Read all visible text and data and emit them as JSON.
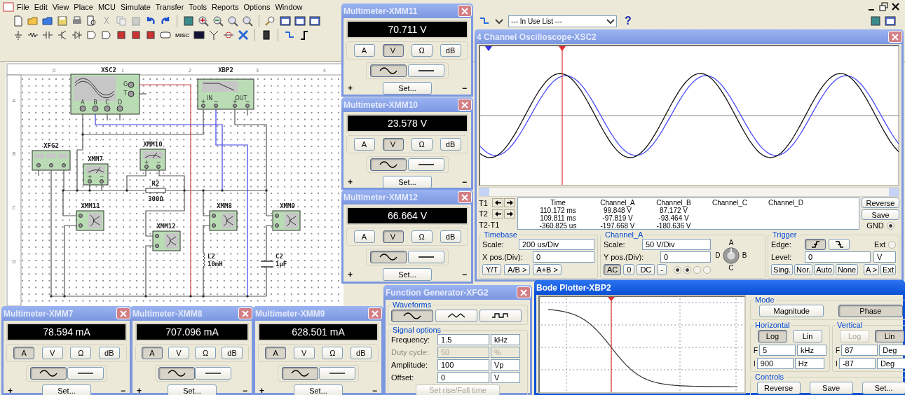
{
  "menu_bar": {
    "items": [
      "File",
      "Edit",
      "View",
      "Place",
      "MCU",
      "Simulate",
      "Transfer",
      "Tools",
      "Reports",
      "Options",
      "Window"
    ]
  },
  "toolbar": {
    "misc_label": "MISC"
  },
  "component_list": {
    "value": "--- In Use List ---"
  },
  "help_label": "?",
  "schematic": {
    "ruler_columns": [
      "0",
      "1",
      "2",
      "3",
      "4"
    ],
    "ruler_rows": [
      "A",
      "B",
      "C",
      "D"
    ],
    "components": [
      {
        "kind": "oscilloscope",
        "label": "XSC2",
        "pins": [
          "G",
          "T",
          "A",
          "B",
          "C",
          "D"
        ]
      },
      {
        "kind": "bode_plotter",
        "label": "XBP2",
        "ports": [
          "IN",
          "OUT"
        ],
        "pins": [
          "+",
          "−",
          "+",
          "−"
        ]
      },
      {
        "kind": "function_generator",
        "label": "XFG2"
      },
      {
        "kind": "voltmeter",
        "label": "XMM10",
        "pins": [
          "+",
          "−"
        ]
      },
      {
        "kind": "voltmeter",
        "label": "XMM7",
        "pins": [
          "+",
          "−"
        ]
      },
      {
        "kind": "resistor",
        "label": "R2",
        "value": "300Ω"
      },
      {
        "kind": "ammeter",
        "label": "XMM11"
      },
      {
        "kind": "ammeter",
        "label": "XMM8"
      },
      {
        "kind": "ammeter",
        "label": "XMM9"
      },
      {
        "kind": "ammeter",
        "label": "XMM12"
      },
      {
        "kind": "inductor",
        "label": "L2",
        "value": "10mH"
      },
      {
        "kind": "capacitor",
        "label": "C2",
        "value": "1μF"
      }
    ]
  },
  "multimeters": [
    {
      "title": "Multimeter-XMM11",
      "active": false,
      "reading": "70.711 V",
      "modes": [
        {
          "label": "A",
          "selected": false
        },
        {
          "label": "V",
          "selected": true
        },
        {
          "label": "Ω",
          "selected": false
        },
        {
          "label": "dB",
          "selected": false
        }
      ],
      "coupling": [
        {
          "kind": "ac",
          "selected": true
        },
        {
          "kind": "dc",
          "selected": false
        }
      ],
      "set_label": "Set...",
      "terminals": [
        "+",
        "−"
      ]
    },
    {
      "title": "Multimeter-XMM10",
      "active": false,
      "reading": "23.578 V",
      "modes": [
        {
          "label": "A",
          "selected": false
        },
        {
          "label": "V",
          "selected": true
        },
        {
          "label": "Ω",
          "selected": false
        },
        {
          "label": "dB",
          "selected": false
        }
      ],
      "coupling": [
        {
          "kind": "ac",
          "selected": true
        },
        {
          "kind": "dc",
          "selected": false
        }
      ],
      "set_label": "Set...",
      "terminals": [
        "+",
        "−"
      ]
    },
    {
      "title": "Multimeter-XMM12",
      "active": false,
      "reading": "66.664 V",
      "modes": [
        {
          "label": "A",
          "selected": false
        },
        {
          "label": "V",
          "selected": true
        },
        {
          "label": "Ω",
          "selected": false
        },
        {
          "label": "dB",
          "selected": false
        }
      ],
      "coupling": [
        {
          "kind": "ac",
          "selected": true
        },
        {
          "kind": "dc",
          "selected": false
        }
      ],
      "set_label": "Set...",
      "terminals": [
        "+",
        "−"
      ]
    },
    {
      "title": "Multimeter-XMM7",
      "active": false,
      "reading": "78.594 mA",
      "modes": [
        {
          "label": "A",
          "selected": true
        },
        {
          "label": "V",
          "selected": false
        },
        {
          "label": "Ω",
          "selected": false
        },
        {
          "label": "dB",
          "selected": false
        }
      ],
      "coupling": [
        {
          "kind": "ac",
          "selected": true
        },
        {
          "kind": "dc",
          "selected": false
        }
      ],
      "set_label": "Set...",
      "terminals": [
        "+",
        "−"
      ]
    },
    {
      "title": "Multimeter-XMM8",
      "active": false,
      "reading": "707.096 mA",
      "modes": [
        {
          "label": "A",
          "selected": true
        },
        {
          "label": "V",
          "selected": false
        },
        {
          "label": "Ω",
          "selected": false
        },
        {
          "label": "dB",
          "selected": false
        }
      ],
      "coupling": [
        {
          "kind": "ac",
          "selected": true
        },
        {
          "kind": "dc",
          "selected": false
        }
      ],
      "set_label": "Set...",
      "terminals": [
        "+",
        "−"
      ]
    },
    {
      "title": "Multimeter-XMM9",
      "active": false,
      "reading": "628.501 mA",
      "modes": [
        {
          "label": "A",
          "selected": true
        },
        {
          "label": "V",
          "selected": false
        },
        {
          "label": "Ω",
          "selected": false
        },
        {
          "label": "dB",
          "selected": false
        }
      ],
      "coupling": [
        {
          "kind": "ac",
          "selected": true
        },
        {
          "kind": "dc",
          "selected": false
        }
      ],
      "set_label": "Set...",
      "terminals": [
        "+",
        "−"
      ]
    }
  ],
  "oscilloscope": {
    "title": "4 Channel Oscilloscope-XSC2",
    "active": false,
    "cursor_rows": [
      {
        "label": "T1",
        "arrows": true
      },
      {
        "label": "T2",
        "arrows": true
      },
      {
        "label": "T2-T1",
        "arrows": false
      }
    ],
    "readout": {
      "columns": [
        "Time",
        "Channel_A",
        "Channel_B",
        "Channel_C",
        "Channel_D"
      ],
      "rows": [
        [
          "110.172 ms",
          "99.848 V",
          "87.172 V"
        ],
        [
          "109.811 ms",
          "-97.819 V",
          "-93.464 V"
        ],
        [
          "-360.825 us",
          "-197.668 V",
          "-180.636 V"
        ]
      ]
    },
    "side_buttons": [
      "Reverse",
      "Save"
    ],
    "gnd_label": "GND",
    "gnd_checked": true,
    "timebase": {
      "title": "Timebase",
      "scale_label": "Scale:",
      "scale": "200 us/Div",
      "xpos_label": "X pos.(Div):",
      "xpos": "0",
      "buttons": [
        "Y/T",
        "A/B >",
        "A+B >"
      ]
    },
    "channel": {
      "title": "Channel_A",
      "scale_label": "Scale:",
      "scale": "50  V/Div",
      "ypos_label": "Y pos.(Div):",
      "ypos": "0",
      "buttons": [
        {
          "label": "AC",
          "selected": true
        },
        {
          "label": "0",
          "selected": false
        },
        {
          "label": "DC",
          "selected": false
        },
        {
          "label": "-",
          "selected": false
        }
      ],
      "knob_labels": [
        "A",
        "B",
        "C",
        "D"
      ],
      "radios": [
        {
          "checked": true
        },
        {
          "checked": true
        },
        {
          "checked": false
        },
        {
          "checked": false
        }
      ]
    },
    "trigger": {
      "title": "Trigger",
      "edge_label": "Edge:",
      "edges": [
        {
          "kind": "rising",
          "selected": true
        },
        {
          "kind": "falling",
          "selected": false
        }
      ],
      "ext_label": "Ext",
      "ext_checked": false,
      "level_label": "Level:",
      "level_value": "0",
      "level_unit": "V",
      "buttons": [
        "Sing.",
        "Nor.",
        "Auto",
        "None"
      ],
      "source_buttons": [
        "A >",
        "Ext"
      ]
    }
  },
  "function_generator": {
    "title": "Function Generator-XFG2",
    "active": false,
    "waveforms_title": "Waveforms",
    "waveforms": [
      {
        "kind": "sine",
        "selected": true
      },
      {
        "kind": "triangle",
        "selected": false
      },
      {
        "kind": "square",
        "selected": false
      }
    ],
    "options_title": "Signal options",
    "fields": [
      {
        "label": "Frequency:",
        "value": "1.5",
        "unit": "kHz",
        "disabled": false
      },
      {
        "label": "Duty cycle:",
        "value": "50",
        "unit": "%",
        "disabled": true
      },
      {
        "label": "Amplitude:",
        "value": "100",
        "unit": "Vp",
        "disabled": false
      },
      {
        "label": "Offset:",
        "value": "0",
        "unit": "V",
        "disabled": false
      }
    ],
    "rise_fall": {
      "label": "Set rise/Fall time",
      "disabled": true
    }
  },
  "bode_plotter": {
    "title": "Bode Plotter-XBP2",
    "active": true,
    "mode_title": "Mode",
    "modes": [
      {
        "label": "Magnitude",
        "selected": false
      },
      {
        "label": "Phase",
        "selected": true
      }
    ],
    "horizontal": {
      "title": "Horizontal",
      "scales": [
        {
          "label": "Log",
          "selected": true,
          "disabled": false
        },
        {
          "label": "Lin",
          "selected": false,
          "disabled": false
        }
      ],
      "limits": [
        {
          "letter": "F",
          "value": "5",
          "unit": "kHz"
        },
        {
          "letter": "I",
          "value": "900",
          "unit": "Hz"
        }
      ]
    },
    "vertical": {
      "title": "Vertical",
      "scales": [
        {
          "label": "Log",
          "selected": false,
          "disabled": true
        },
        {
          "label": "Lin",
          "selected": true,
          "disabled": false
        }
      ],
      "limits": [
        {
          "letter": "F",
          "value": "87",
          "unit": "Deg"
        },
        {
          "letter": "I",
          "value": "-87",
          "unit": "Deg"
        }
      ]
    },
    "controls_title": "Controls",
    "buttons": [
      "Reverse",
      "Save",
      "Set..."
    ]
  }
}
